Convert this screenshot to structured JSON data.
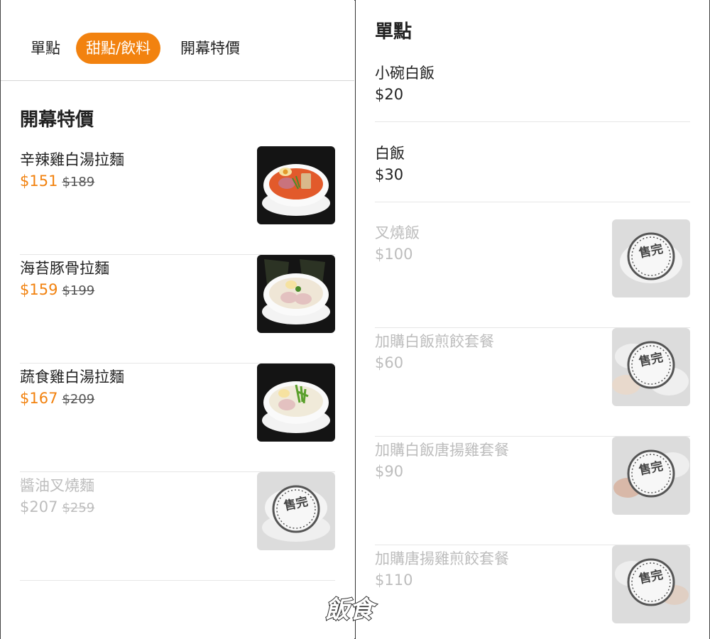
{
  "tabs": [
    {
      "label": "單點",
      "active": false
    },
    {
      "label": "甜點/飲料",
      "active": true
    },
    {
      "label": "開幕特價",
      "active": false
    }
  ],
  "left": {
    "section_title": "開幕特價",
    "items": [
      {
        "name": "辛辣雞白湯拉麵",
        "price": "$151",
        "original_price": "$189",
        "sold_out": false
      },
      {
        "name": "海苔豚骨拉麵",
        "price": "$159",
        "original_price": "$199",
        "sold_out": false
      },
      {
        "name": "蔬食雞白湯拉麵",
        "price": "$167",
        "original_price": "$209",
        "sold_out": false
      },
      {
        "name": "醬油叉燒麵",
        "price": "$207",
        "original_price": "$259",
        "sold_out": true,
        "sold_out_label": "售完"
      }
    ]
  },
  "right": {
    "section_title": "單點",
    "items": [
      {
        "name": "小碗白飯",
        "price": "$20",
        "sold_out": false
      },
      {
        "name": "白飯",
        "price": "$30",
        "sold_out": false
      },
      {
        "name": "叉燒飯",
        "price": "$100",
        "sold_out": true,
        "sold_out_label": "售完"
      },
      {
        "name": "加購白飯煎餃套餐",
        "price": "$60",
        "sold_out": true,
        "sold_out_label": "售完"
      },
      {
        "name": "加購白飯唐揚雞套餐",
        "price": "$90",
        "sold_out": true,
        "sold_out_label": "售完"
      },
      {
        "name": "加購唐揚雞煎餃套餐",
        "price": "$110",
        "sold_out": true,
        "sold_out_label": "售完"
      }
    ]
  },
  "watermark": {
    "text": "飯食"
  },
  "colors": {
    "accent": "#f2820f",
    "sold_out_text": "#bdbdbd"
  }
}
